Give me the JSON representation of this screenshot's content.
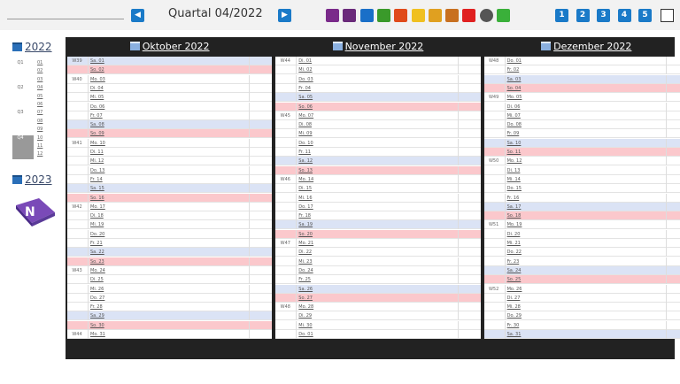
{
  "header": {
    "title": "Quartal 04/2022",
    "prev_label": "◀",
    "next_label": "▶",
    "toolbar_icons": [
      {
        "name": "user-icon",
        "color": "#7a2a8a"
      },
      {
        "name": "book-icon",
        "color": "#6a2a7a"
      },
      {
        "name": "blue-book-icon",
        "color": "#1a6fc8"
      },
      {
        "name": "green-book-icon",
        "color": "#3a9a2a"
      },
      {
        "name": "red-book-icon",
        "color": "#e04a1a"
      },
      {
        "name": "star-icon",
        "color": "#f0c020"
      },
      {
        "name": "lock-icon",
        "color": "#e0a020"
      },
      {
        "name": "star-person-icon",
        "color": "#c87020"
      },
      {
        "name": "bell-icon",
        "color": "#e02020"
      },
      {
        "name": "clock-icon",
        "color": "#555555"
      },
      {
        "name": "check-icon",
        "color": "#3ab03a"
      }
    ],
    "number_buttons": [
      "1",
      "2",
      "3",
      "4",
      "5"
    ]
  },
  "sidebar": {
    "year_current": "2022",
    "year_next": "2023",
    "quarters": [
      {
        "label": "Q1",
        "months": [
          "01",
          "02",
          "03"
        ]
      },
      {
        "label": "Q2",
        "months": [
          "04",
          "05",
          "06"
        ]
      },
      {
        "label": "Q3",
        "months": [
          "07",
          "08",
          "09"
        ]
      },
      {
        "label": "Q4",
        "months": [
          "10",
          "11",
          "12"
        ],
        "selected": true
      }
    ]
  },
  "months": [
    {
      "title": "Oktober 2022",
      "days": [
        {
          "w": "W39",
          "d": "Sa. 01",
          "t": "sat"
        },
        {
          "w": "",
          "d": "So. 02",
          "t": "sun"
        },
        {
          "w": "W40",
          "d": "Mo. 03",
          "t": ""
        },
        {
          "w": "",
          "d": "Di. 04",
          "t": ""
        },
        {
          "w": "",
          "d": "Mi. 05",
          "t": ""
        },
        {
          "w": "",
          "d": "Do. 06",
          "t": ""
        },
        {
          "w": "",
          "d": "Fr. 07",
          "t": ""
        },
        {
          "w": "",
          "d": "Sa. 08",
          "t": "sat"
        },
        {
          "w": "",
          "d": "So. 09",
          "t": "sun"
        },
        {
          "w": "W41",
          "d": "Mo. 10",
          "t": ""
        },
        {
          "w": "",
          "d": "Di. 11",
          "t": ""
        },
        {
          "w": "",
          "d": "Mi. 12",
          "t": ""
        },
        {
          "w": "",
          "d": "Do. 13",
          "t": ""
        },
        {
          "w": "",
          "d": "Fr. 14",
          "t": ""
        },
        {
          "w": "",
          "d": "Sa. 15",
          "t": "sat"
        },
        {
          "w": "",
          "d": "So. 16",
          "t": "sun"
        },
        {
          "w": "W42",
          "d": "Mo. 17",
          "t": ""
        },
        {
          "w": "",
          "d": "Di. 18",
          "t": ""
        },
        {
          "w": "",
          "d": "Mi. 19",
          "t": ""
        },
        {
          "w": "",
          "d": "Do. 20",
          "t": ""
        },
        {
          "w": "",
          "d": "Fr. 21",
          "t": ""
        },
        {
          "w": "",
          "d": "Sa. 22",
          "t": "sat"
        },
        {
          "w": "",
          "d": "So. 23",
          "t": "sun"
        },
        {
          "w": "W43",
          "d": "Mo. 24",
          "t": ""
        },
        {
          "w": "",
          "d": "Di. 25",
          "t": ""
        },
        {
          "w": "",
          "d": "Mi. 26",
          "t": ""
        },
        {
          "w": "",
          "d": "Do. 27",
          "t": ""
        },
        {
          "w": "",
          "d": "Fr. 28",
          "t": ""
        },
        {
          "w": "",
          "d": "Sa. 29",
          "t": "sat"
        },
        {
          "w": "",
          "d": "So. 30",
          "t": "sun"
        },
        {
          "w": "W44",
          "d": "Mo. 31",
          "t": ""
        }
      ]
    },
    {
      "title": "November 2022",
      "days": [
        {
          "w": "W44",
          "d": "Di. 01",
          "t": ""
        },
        {
          "w": "",
          "d": "Mi. 02",
          "t": ""
        },
        {
          "w": "",
          "d": "Do. 03",
          "t": ""
        },
        {
          "w": "",
          "d": "Fr. 04",
          "t": ""
        },
        {
          "w": "",
          "d": "Sa. 05",
          "t": "sat"
        },
        {
          "w": "",
          "d": "So. 06",
          "t": "sun"
        },
        {
          "w": "W45",
          "d": "Mo. 07",
          "t": ""
        },
        {
          "w": "",
          "d": "Di. 08",
          "t": ""
        },
        {
          "w": "",
          "d": "Mi. 09",
          "t": ""
        },
        {
          "w": "",
          "d": "Do. 10",
          "t": ""
        },
        {
          "w": "",
          "d": "Fr. 11",
          "t": ""
        },
        {
          "w": "",
          "d": "Sa. 12",
          "t": "sat"
        },
        {
          "w": "",
          "d": "So. 13",
          "t": "sun"
        },
        {
          "w": "W46",
          "d": "Mo. 14",
          "t": ""
        },
        {
          "w": "",
          "d": "Di. 15",
          "t": ""
        },
        {
          "w": "",
          "d": "Mi. 16",
          "t": ""
        },
        {
          "w": "",
          "d": "Do. 17",
          "t": ""
        },
        {
          "w": "",
          "d": "Fr. 18",
          "t": ""
        },
        {
          "w": "",
          "d": "Sa. 19",
          "t": "sat"
        },
        {
          "w": "",
          "d": "So. 20",
          "t": "sun"
        },
        {
          "w": "W47",
          "d": "Mo. 21",
          "t": ""
        },
        {
          "w": "",
          "d": "Di. 22",
          "t": ""
        },
        {
          "w": "",
          "d": "Mi. 23",
          "t": ""
        },
        {
          "w": "",
          "d": "Do. 24",
          "t": ""
        },
        {
          "w": "",
          "d": "Fr. 25",
          "t": ""
        },
        {
          "w": "",
          "d": "Sa. 26",
          "t": "sat"
        },
        {
          "w": "",
          "d": "So. 27",
          "t": "sun"
        },
        {
          "w": "W48",
          "d": "Mo. 28",
          "t": ""
        },
        {
          "w": "",
          "d": "Di. 29",
          "t": ""
        },
        {
          "w": "",
          "d": "Mi. 30",
          "t": ""
        },
        {
          "w": "",
          "d": "Do. 01",
          "t": ""
        }
      ]
    },
    {
      "title": "Dezember 2022",
      "days": [
        {
          "w": "W48",
          "d": "Do. 01",
          "t": ""
        },
        {
          "w": "",
          "d": "Fr. 02",
          "t": ""
        },
        {
          "w": "",
          "d": "Sa. 03",
          "t": "sat"
        },
        {
          "w": "",
          "d": "So. 04",
          "t": "sun"
        },
        {
          "w": "W49",
          "d": "Mo. 05",
          "t": ""
        },
        {
          "w": "",
          "d": "Di. 06",
          "t": ""
        },
        {
          "w": "",
          "d": "Mi. 07",
          "t": ""
        },
        {
          "w": "",
          "d": "Do. 08",
          "t": ""
        },
        {
          "w": "",
          "d": "Fr. 09",
          "t": ""
        },
        {
          "w": "",
          "d": "Sa. 10",
          "t": "sat"
        },
        {
          "w": "",
          "d": "So. 11",
          "t": "sun"
        },
        {
          "w": "W50",
          "d": "Mo. 12",
          "t": ""
        },
        {
          "w": "",
          "d": "Di. 13",
          "t": ""
        },
        {
          "w": "",
          "d": "Mi. 14",
          "t": ""
        },
        {
          "w": "",
          "d": "Do. 15",
          "t": ""
        },
        {
          "w": "",
          "d": "Fr. 16",
          "t": ""
        },
        {
          "w": "",
          "d": "Sa. 17",
          "t": "sat"
        },
        {
          "w": "",
          "d": "So. 18",
          "t": "sun"
        },
        {
          "w": "W51",
          "d": "Mo. 19",
          "t": ""
        },
        {
          "w": "",
          "d": "Di. 20",
          "t": ""
        },
        {
          "w": "",
          "d": "Mi. 21",
          "t": ""
        },
        {
          "w": "",
          "d": "Do. 22",
          "t": ""
        },
        {
          "w": "",
          "d": "Fr. 23",
          "t": ""
        },
        {
          "w": "",
          "d": "Sa. 24",
          "t": "sat"
        },
        {
          "w": "",
          "d": "So. 25",
          "t": "sun"
        },
        {
          "w": "W52",
          "d": "Mo. 26",
          "t": ""
        },
        {
          "w": "",
          "d": "Di. 27",
          "t": ""
        },
        {
          "w": "",
          "d": "Mi. 28",
          "t": ""
        },
        {
          "w": "",
          "d": "Do. 29",
          "t": ""
        },
        {
          "w": "",
          "d": "Fr. 30",
          "t": ""
        },
        {
          "w": "",
          "d": "Sa. 31",
          "t": "sat"
        }
      ]
    }
  ]
}
